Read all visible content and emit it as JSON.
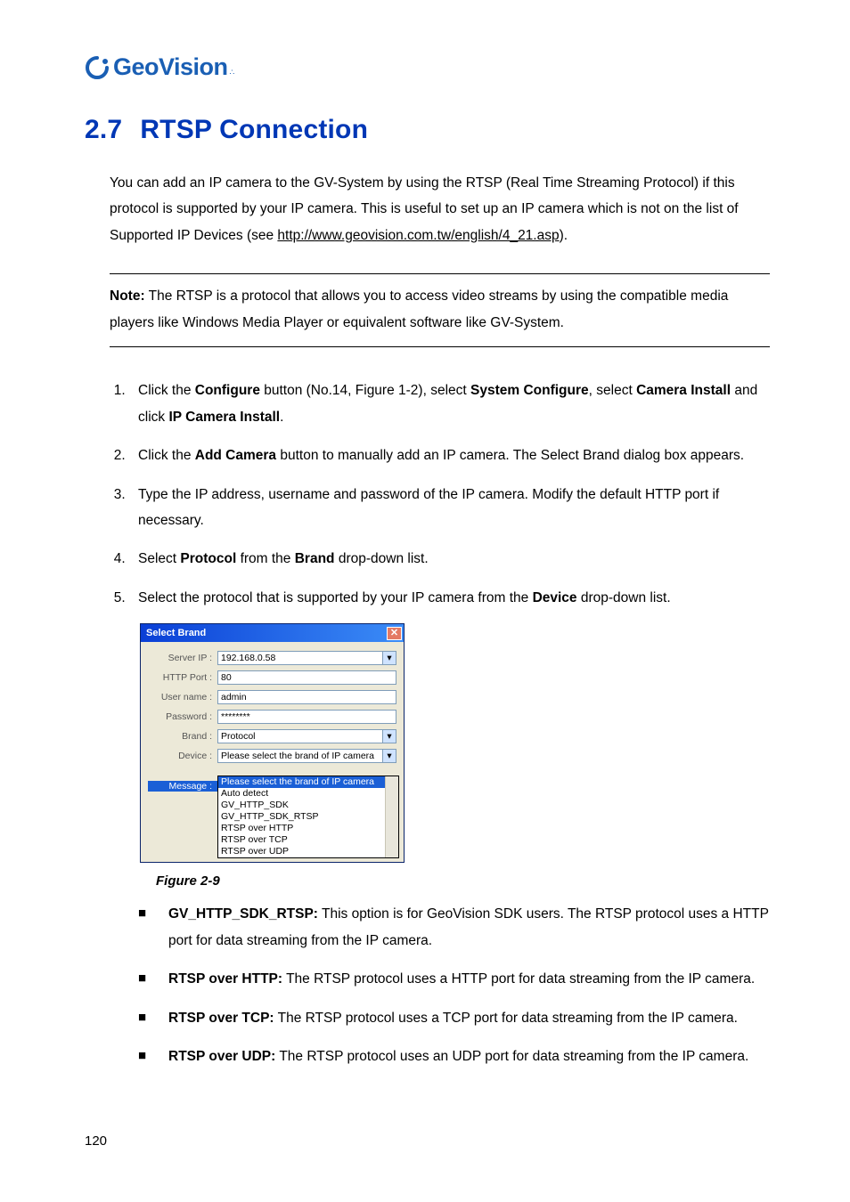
{
  "logo": {
    "brand": "GeoVision"
  },
  "heading": {
    "number": "2.7",
    "title": "RTSP Connection"
  },
  "intro": {
    "text_before_link": "You can add an IP camera to the GV-System by using the RTSP (Real Time Streaming Protocol) if this protocol is supported by your IP camera. This is useful to set up an IP camera which is not on the list of Supported IP Devices (see ",
    "link_text": "http://www.geovision.com.tw/english/4_21.asp",
    "text_after_link": ")."
  },
  "note": {
    "label": "Note:",
    "text": " The RTSP is a protocol that allows you to access video streams by using the compatible media players like Windows Media Player or equivalent software like GV-System."
  },
  "steps": [
    {
      "pre": "Click the ",
      "b1": "Configure",
      "mid1": " button (No.14, Figure 1-2), select ",
      "b2": "System Configure",
      "mid2": ", select ",
      "b3": "Camera Install",
      "mid3": " and click ",
      "b4": "IP Camera Install",
      "post": "."
    },
    {
      "pre": "Click the ",
      "b1": "Add Camera",
      "mid1": " button to manually add an IP camera. The Select Brand dialog box appears.",
      "b2": "",
      "mid2": "",
      "b3": "",
      "mid3": "",
      "b4": "",
      "post": ""
    },
    {
      "pre": "Type the IP address, username and password of the IP camera. Modify the default HTTP port if necessary.",
      "b1": "",
      "mid1": "",
      "b2": "",
      "mid2": "",
      "b3": "",
      "mid3": "",
      "b4": "",
      "post": ""
    },
    {
      "pre": "Select ",
      "b1": "Protocol",
      "mid1": " from the ",
      "b2": "Brand",
      "mid2": " drop-down list.",
      "b3": "",
      "mid3": "",
      "b4": "",
      "post": ""
    },
    {
      "pre": "Select the protocol that is supported by your IP camera from the ",
      "b1": "Device",
      "mid1": " drop-down list.",
      "b2": "",
      "mid2": "",
      "b3": "",
      "mid3": "",
      "b4": "",
      "post": ""
    }
  ],
  "dialog": {
    "title": "Select Brand",
    "fields": {
      "server_ip": {
        "label": "Server IP :",
        "value": "192.168.0.58"
      },
      "http_port": {
        "label": "HTTP Port :",
        "value": "80"
      },
      "user_name": {
        "label": "User name :",
        "value": "admin"
      },
      "password": {
        "label": "Password :",
        "value": "********"
      },
      "brand": {
        "label": "Brand :",
        "value": "Protocol"
      },
      "device": {
        "label": "Device :",
        "value": "Please select the brand of IP camera"
      },
      "message": {
        "label": "Message :"
      }
    },
    "device_options": [
      "Please select the brand of IP camera",
      "Auto detect",
      "GV_HTTP_SDK",
      "GV_HTTP_SDK_RTSP",
      "RTSP over HTTP",
      "RTSP over TCP",
      "RTSP over UDP"
    ]
  },
  "figure_caption": "Figure 2-9",
  "bullets": [
    {
      "b": "GV_HTTP_SDK_RTSP:",
      "t": " This option is for GeoVision SDK users. The RTSP protocol uses a HTTP port for data streaming from the IP camera."
    },
    {
      "b": "RTSP over HTTP:",
      "t": " The RTSP protocol uses a HTTP port for data streaming from the IP camera."
    },
    {
      "b": "RTSP over TCP:",
      "t": " The RTSP protocol uses a TCP port for data streaming from the IP camera."
    },
    {
      "b": "RTSP over UDP:",
      "t": " The RTSP protocol uses an UDP port for data streaming from the IP camera."
    }
  ],
  "page_number": "120"
}
